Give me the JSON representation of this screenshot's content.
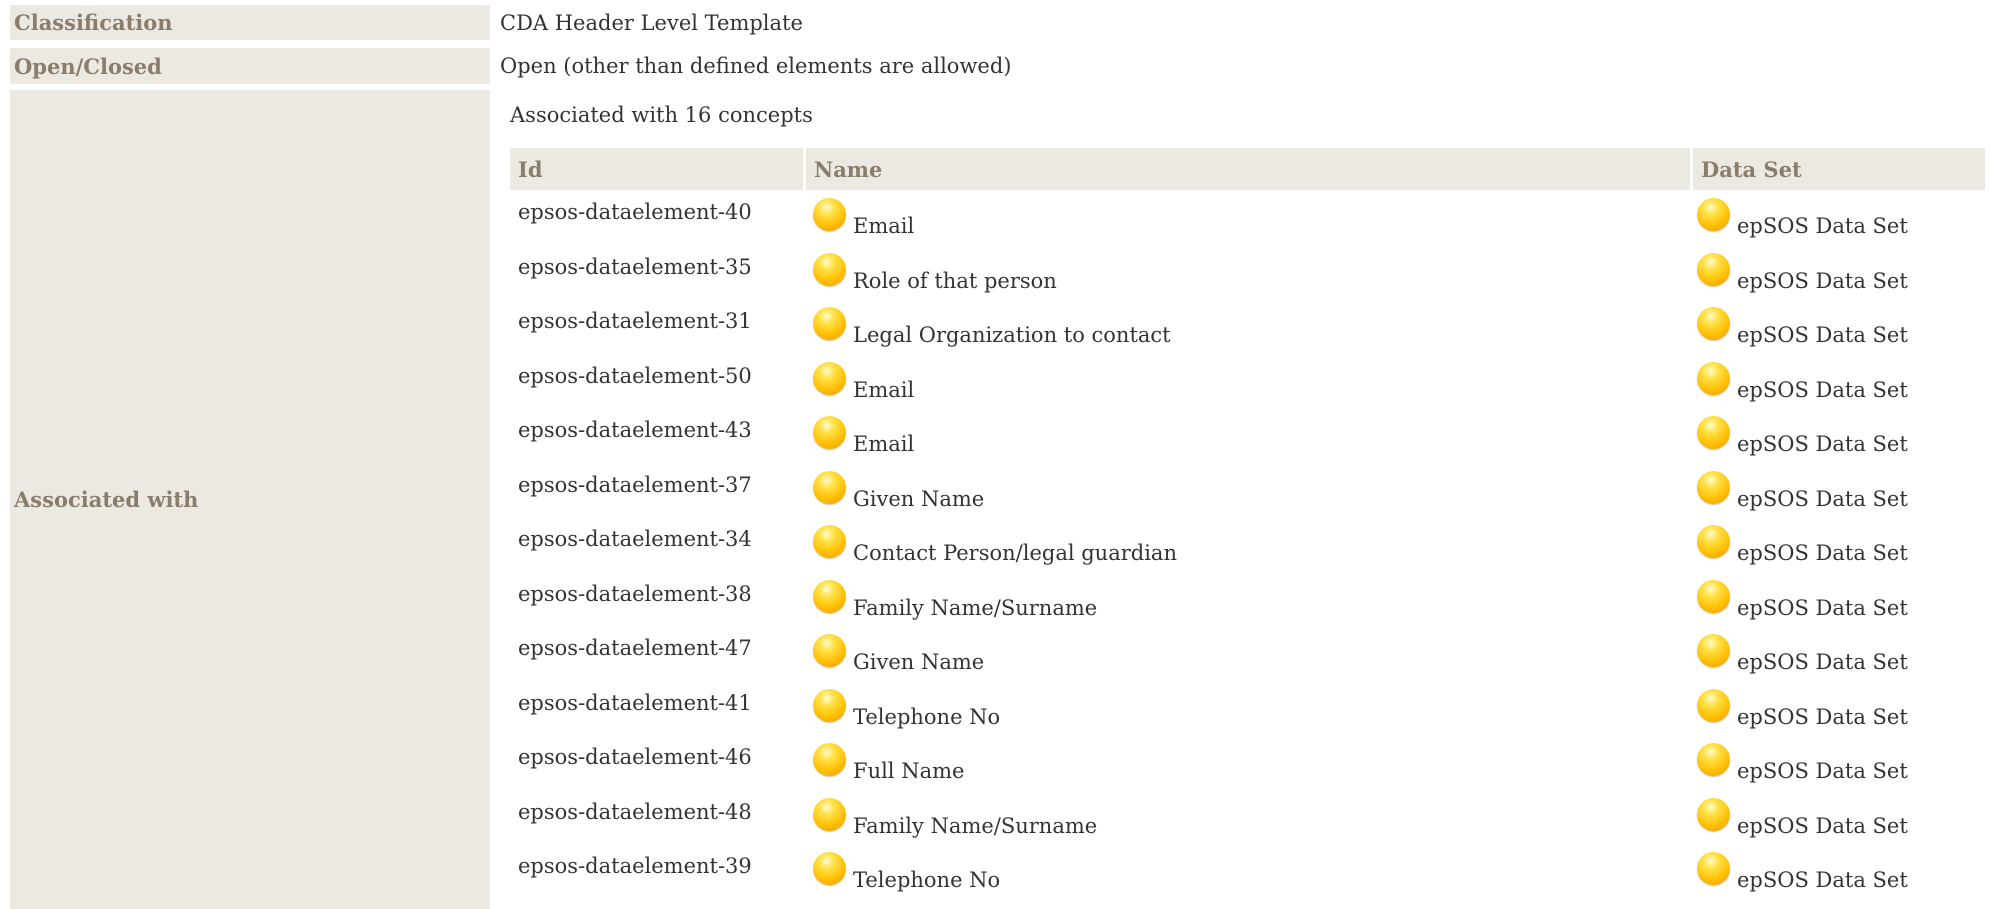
{
  "template": {
    "classification_label": "Classification",
    "classification_value": "CDA Header Level Template",
    "open_closed_label": "Open/Closed",
    "open_closed_value": "Open (other than defined elements are allowed)",
    "associated_label": "Associated with",
    "associated_caption": "Associated with 16 concepts"
  },
  "concepts_table": {
    "headers": [
      "Id",
      "Name",
      "Data Set"
    ],
    "bullet_color": "#ffbe00",
    "rows": [
      {
        "id": "epsos-dataelement-40",
        "name": "Email",
        "dataset": "epSOS Data Set"
      },
      {
        "id": "epsos-dataelement-35",
        "name": "Role of that person",
        "dataset": "epSOS Data Set"
      },
      {
        "id": "epsos-dataelement-31",
        "name": "Legal Organization to contact",
        "dataset": "epSOS Data Set"
      },
      {
        "id": "epsos-dataelement-50",
        "name": "Email",
        "dataset": "epSOS Data Set"
      },
      {
        "id": "epsos-dataelement-43",
        "name": "Email",
        "dataset": "epSOS Data Set"
      },
      {
        "id": "epsos-dataelement-37",
        "name": "Given Name",
        "dataset": "epSOS Data Set"
      },
      {
        "id": "epsos-dataelement-34",
        "name": "Contact Person/legal guardian",
        "dataset": "epSOS Data Set"
      },
      {
        "id": "epsos-dataelement-38",
        "name": "Family Name/Surname",
        "dataset": "epSOS Data Set"
      },
      {
        "id": "epsos-dataelement-47",
        "name": "Given Name",
        "dataset": "epSOS Data Set"
      },
      {
        "id": "epsos-dataelement-41",
        "name": "Telephone No",
        "dataset": "epSOS Data Set"
      },
      {
        "id": "epsos-dataelement-46",
        "name": "Full Name",
        "dataset": "epSOS Data Set"
      },
      {
        "id": "epsos-dataelement-48",
        "name": "Family Name/Surname",
        "dataset": "epSOS Data Set"
      },
      {
        "id": "epsos-dataelement-39",
        "name": "Telephone No",
        "dataset": "epSOS Data Set"
      }
    ]
  }
}
